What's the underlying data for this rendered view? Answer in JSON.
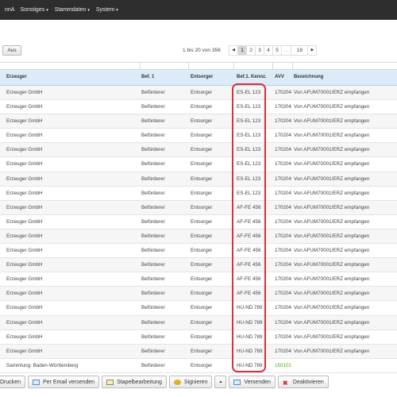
{
  "nav": {
    "items": [
      {
        "label": "nnA",
        "caret": false
      },
      {
        "label": "Sonstiges",
        "caret": true
      },
      {
        "label": "Stammdaten",
        "caret": true
      },
      {
        "label": "System",
        "caret": true
      }
    ]
  },
  "toolbar": {
    "aus_label": "Aus",
    "pager_info": "1 bis 20 von 356",
    "pages": [
      "1",
      "2",
      "3",
      "4",
      "5",
      "...",
      "18"
    ],
    "active_page": "1"
  },
  "table": {
    "headers": {
      "erzeuger": "Erzeuger",
      "bef1": "Bef. 1",
      "entsorger": "Entsorger",
      "kennz": "Bef.1. Kennz.",
      "avv": "AVV",
      "bezeichnung": "Bezeichnung"
    },
    "rows": [
      {
        "erzeuger": "Erzeuger GmbH",
        "bef1": "Beförderer",
        "entsorger": "Entsorger",
        "kennz": "ES-EL 123",
        "avv": "170204",
        "bezeichnung": "Von AFUM70001/ERZ empfangen"
      },
      {
        "erzeuger": "Erzeuger GmbH",
        "bef1": "Beförderer",
        "entsorger": "Entsorger",
        "kennz": "ES-EL 123",
        "avv": "170204",
        "bezeichnung": "Von AFUM70001/ERZ empfangen"
      },
      {
        "erzeuger": "Erzeuger GmbH",
        "bef1": "Beförderer",
        "entsorger": "Entsorger",
        "kennz": "ES-EL 123",
        "avv": "170204",
        "bezeichnung": "Von AFUM70001/ERZ empfangen"
      },
      {
        "erzeuger": "Erzeuger GmbH",
        "bef1": "Beförderer",
        "entsorger": "Entsorger",
        "kennz": "ES-EL 123",
        "avv": "170204",
        "bezeichnung": "Von AFUM70001/ERZ empfangen"
      },
      {
        "erzeuger": "Erzeuger GmbH",
        "bef1": "Beförderer",
        "entsorger": "Entsorger",
        "kennz": "ES-EL 123",
        "avv": "170204",
        "bezeichnung": "Von AFUM70001/ERZ empfangen"
      },
      {
        "erzeuger": "Erzeuger GmbH",
        "bef1": "Beförderer",
        "entsorger": "Entsorger",
        "kennz": "ES-EL 123",
        "avv": "170204",
        "bezeichnung": "Von AFUM70001/ERZ empfangen"
      },
      {
        "erzeuger": "Erzeuger GmbH",
        "bef1": "Beförderer",
        "entsorger": "Entsorger",
        "kennz": "ES-EL 123",
        "avv": "170204",
        "bezeichnung": "Von AFUM70001/ERZ empfangen"
      },
      {
        "erzeuger": "Erzeuger GmbH",
        "bef1": "Beförderer",
        "entsorger": "Entsorger",
        "kennz": "ES-EL 123",
        "avv": "170204",
        "bezeichnung": "Von AFUM70001/ERZ empfangen"
      },
      {
        "erzeuger": "Erzeuger GmbH",
        "bef1": "Beförderer",
        "entsorger": "Entsorger",
        "kennz": "AF-FE 456",
        "avv": "170204",
        "bezeichnung": "Von AFUM70001/ERZ empfangen"
      },
      {
        "erzeuger": "Erzeuger GmbH",
        "bef1": "Beförderer",
        "entsorger": "Entsorger",
        "kennz": "AF-FE 456",
        "avv": "170204",
        "bezeichnung": "Von AFUM70001/ERZ empfangen"
      },
      {
        "erzeuger": "Erzeuger GmbH",
        "bef1": "Beförderer",
        "entsorger": "Entsorger",
        "kennz": "AF-FE 456",
        "avv": "170204",
        "bezeichnung": "Von AFUM70001/ERZ empfangen"
      },
      {
        "erzeuger": "Erzeuger GmbH",
        "bef1": "Beförderer",
        "entsorger": "Entsorger",
        "kennz": "AF-FE 456",
        "avv": "170204",
        "bezeichnung": "Von AFUM70001/ERZ empfangen"
      },
      {
        "erzeuger": "Erzeuger GmbH",
        "bef1": "Beförderer",
        "entsorger": "Entsorger",
        "kennz": "AF-FE 456",
        "avv": "170204",
        "bezeichnung": "Von AFUM70001/ERZ empfangen"
      },
      {
        "erzeuger": "Erzeuger GmbH",
        "bef1": "Beförderer",
        "entsorger": "Entsorger",
        "kennz": "AF-FE 456",
        "avv": "170204",
        "bezeichnung": "Von AFUM70001/ERZ empfangen"
      },
      {
        "erzeuger": "Erzeuger GmbH",
        "bef1": "Beförderer",
        "entsorger": "Entsorger",
        "kennz": "AF-FE 456",
        "avv": "170204",
        "bezeichnung": "Von AFUM70001/ERZ empfangen"
      },
      {
        "erzeuger": "Erzeuger GmbH",
        "bef1": "Beförderer",
        "entsorger": "Entsorger",
        "kennz": "HU-ND 789",
        "avv": "170204",
        "bezeichnung": "Von AFUM70001/ERZ empfangen"
      },
      {
        "erzeuger": "Erzeuger GmbH",
        "bef1": "Beförderer",
        "entsorger": "Entsorger",
        "kennz": "HU-ND 789",
        "avv": "170204",
        "bezeichnung": "Von AFUM70001/ERZ empfangen"
      },
      {
        "erzeuger": "Erzeuger GmbH",
        "bef1": "Beförderer",
        "entsorger": "Entsorger",
        "kennz": "HU-ND 789",
        "avv": "170204",
        "bezeichnung": "Von AFUM70001/ERZ empfangen"
      },
      {
        "erzeuger": "Erzeuger GmbH",
        "bef1": "Beförderer",
        "entsorger": "Entsorger",
        "kennz": "HU-ND 789",
        "avv": "170204",
        "bezeichnung": "Von AFUM70001/ERZ empfangen"
      },
      {
        "erzeuger": "Sammlung: Baden-Württemberg",
        "bef1": "Beförderer",
        "entsorger": "Entsorger",
        "kennz": "HU-ND 789",
        "avv": "150101",
        "avv_green": true,
        "bezeichnung": ""
      }
    ]
  },
  "actions": {
    "drucken": "Drucken",
    "email": "Per Email versenden",
    "stapel": "Stapelbearbeitung",
    "signieren": "Signieren",
    "versenden": "Versenden",
    "deaktivieren": "Deaktivieren"
  },
  "colors": {
    "navbar": "#2e2e2e",
    "header_bg": "#dcebf7",
    "highlight": "#d9303b",
    "avv_green": "#4caf1f"
  }
}
